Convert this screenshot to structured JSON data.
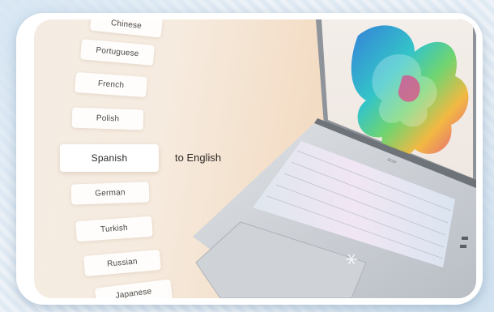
{
  "languages": {
    "items": [
      "Chinese",
      "Portuguese",
      "French",
      "Polish",
      "Spanish",
      "German",
      "Turkish",
      "Russian",
      "Japanese"
    ],
    "selected": "Spanish"
  },
  "translation": {
    "target_text": "to English"
  },
  "laptop": {
    "brand": "acer",
    "logo_icon": "snowflake-icon"
  },
  "colors": {
    "background": "#f4ece3",
    "card": "#ffffff",
    "laptop_silver": "#c9cdd2"
  }
}
